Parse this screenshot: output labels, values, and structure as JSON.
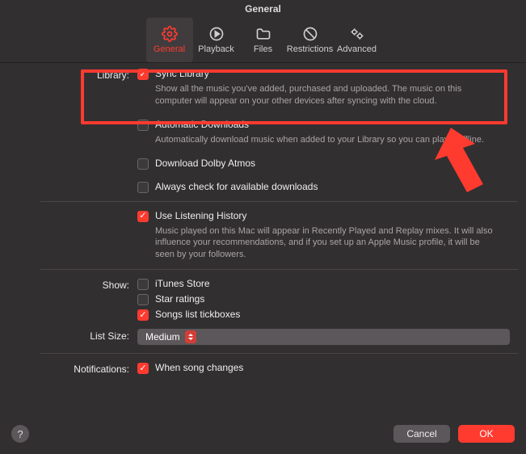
{
  "title": "General",
  "toolbar": {
    "general": "General",
    "playback": "Playback",
    "files": "Files",
    "restrictions": "Restrictions",
    "advanced": "Advanced"
  },
  "labels": {
    "library": "Library:",
    "show": "Show:",
    "listsize": "List Size:",
    "notifications": "Notifications:"
  },
  "library": {
    "sync_label": "Sync Library",
    "sync_desc": "Show all the music you've added, purchased and uploaded. The music on this computer will appear on your other devices after syncing with the cloud.",
    "auto_label": "Automatic Downloads",
    "auto_desc": "Automatically download music when added to your Library so you can play it offline.",
    "dolby_label": "Download Dolby Atmos",
    "checkdl_label": "Always check for available downloads"
  },
  "listening": {
    "label": "Use Listening History",
    "desc": "Music played on this Mac will appear in Recently Played and Replay mixes. It will also influence your recommendations, and if you set up an Apple Music profile, it will be seen by your followers."
  },
  "show": {
    "itunes": "iTunes Store",
    "star": "Star ratings",
    "tickboxes": "Songs list tickboxes"
  },
  "listsize_value": "Medium",
  "notifications_label": "When song changes",
  "footer": {
    "cancel": "Cancel",
    "ok": "OK"
  }
}
